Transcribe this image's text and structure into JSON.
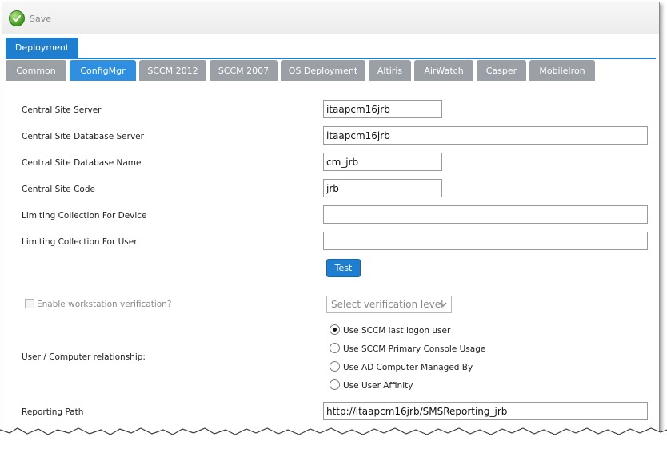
{
  "toolbar": {
    "save_label": "Save"
  },
  "deployment_tab": "Deployment",
  "subtabs": [
    "Common",
    "ConfigMgr",
    "SCCM 2012",
    "SCCM 2007",
    "OS Deployment",
    "Altiris",
    "AirWatch",
    "Casper",
    "MobileIron"
  ],
  "active_subtab": "ConfigMgr",
  "form": {
    "central_site_server": {
      "label": "Central Site Server",
      "value": "itaapcm16jrb"
    },
    "central_site_db_server": {
      "label": "Central Site Database Server",
      "value": "itaapcm16jrb"
    },
    "central_site_db_name": {
      "label": "Central Site Database Name",
      "value": "cm_jrb"
    },
    "central_site_code": {
      "label": "Central Site Code",
      "value": "jrb"
    },
    "limiting_collection_device": {
      "label": "Limiting Collection For Device",
      "value": ""
    },
    "limiting_collection_user": {
      "label": "Limiting Collection For User",
      "value": ""
    },
    "test_label": "Test",
    "workstation_verification": {
      "label": "Enable workstation verification?",
      "checked": false,
      "disabled": true
    },
    "verification_level": {
      "selected": "Select verification level"
    },
    "relationship": {
      "label": "User / Computer relationship:",
      "options": [
        "Use SCCM last logon user",
        "Use SCCM Primary Console Usage",
        "Use AD Computer Managed By",
        "Use User Affinity"
      ],
      "selected": "Use SCCM last logon user"
    },
    "reporting_path": {
      "label": "Reporting Path",
      "value": "http://itaapcm16jrb/SMSReporting_jrb"
    }
  },
  "colors": {
    "accent": "#1e7fd0",
    "tab_inactive": "#9aa0a6",
    "tab_active": "#2f8fe0"
  },
  "icons": {
    "save": "check-circle-icon",
    "select": "chevron-down-icon"
  }
}
